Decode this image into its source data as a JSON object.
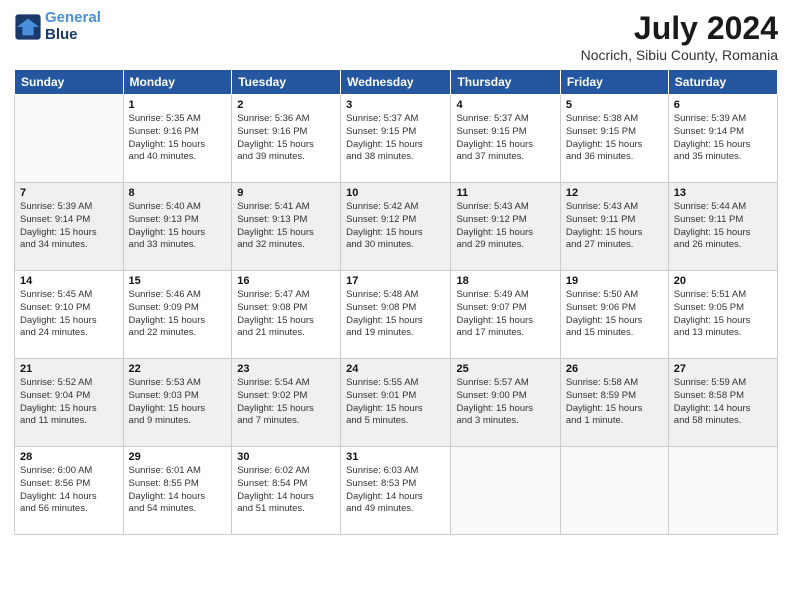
{
  "logo": {
    "line1": "General",
    "line2": "Blue"
  },
  "title": "July 2024",
  "location": "Nocrich, Sibiu County, Romania",
  "weekdays": [
    "Sunday",
    "Monday",
    "Tuesday",
    "Wednesday",
    "Thursday",
    "Friday",
    "Saturday"
  ],
  "weeks": [
    [
      {
        "day": "",
        "info": ""
      },
      {
        "day": "1",
        "info": "Sunrise: 5:35 AM\nSunset: 9:16 PM\nDaylight: 15 hours\nand 40 minutes."
      },
      {
        "day": "2",
        "info": "Sunrise: 5:36 AM\nSunset: 9:16 PM\nDaylight: 15 hours\nand 39 minutes."
      },
      {
        "day": "3",
        "info": "Sunrise: 5:37 AM\nSunset: 9:15 PM\nDaylight: 15 hours\nand 38 minutes."
      },
      {
        "day": "4",
        "info": "Sunrise: 5:37 AM\nSunset: 9:15 PM\nDaylight: 15 hours\nand 37 minutes."
      },
      {
        "day": "5",
        "info": "Sunrise: 5:38 AM\nSunset: 9:15 PM\nDaylight: 15 hours\nand 36 minutes."
      },
      {
        "day": "6",
        "info": "Sunrise: 5:39 AM\nSunset: 9:14 PM\nDaylight: 15 hours\nand 35 minutes."
      }
    ],
    [
      {
        "day": "7",
        "info": "Sunrise: 5:39 AM\nSunset: 9:14 PM\nDaylight: 15 hours\nand 34 minutes."
      },
      {
        "day": "8",
        "info": "Sunrise: 5:40 AM\nSunset: 9:13 PM\nDaylight: 15 hours\nand 33 minutes."
      },
      {
        "day": "9",
        "info": "Sunrise: 5:41 AM\nSunset: 9:13 PM\nDaylight: 15 hours\nand 32 minutes."
      },
      {
        "day": "10",
        "info": "Sunrise: 5:42 AM\nSunset: 9:12 PM\nDaylight: 15 hours\nand 30 minutes."
      },
      {
        "day": "11",
        "info": "Sunrise: 5:43 AM\nSunset: 9:12 PM\nDaylight: 15 hours\nand 29 minutes."
      },
      {
        "day": "12",
        "info": "Sunrise: 5:43 AM\nSunset: 9:11 PM\nDaylight: 15 hours\nand 27 minutes."
      },
      {
        "day": "13",
        "info": "Sunrise: 5:44 AM\nSunset: 9:11 PM\nDaylight: 15 hours\nand 26 minutes."
      }
    ],
    [
      {
        "day": "14",
        "info": "Sunrise: 5:45 AM\nSunset: 9:10 PM\nDaylight: 15 hours\nand 24 minutes."
      },
      {
        "day": "15",
        "info": "Sunrise: 5:46 AM\nSunset: 9:09 PM\nDaylight: 15 hours\nand 22 minutes."
      },
      {
        "day": "16",
        "info": "Sunrise: 5:47 AM\nSunset: 9:08 PM\nDaylight: 15 hours\nand 21 minutes."
      },
      {
        "day": "17",
        "info": "Sunrise: 5:48 AM\nSunset: 9:08 PM\nDaylight: 15 hours\nand 19 minutes."
      },
      {
        "day": "18",
        "info": "Sunrise: 5:49 AM\nSunset: 9:07 PM\nDaylight: 15 hours\nand 17 minutes."
      },
      {
        "day": "19",
        "info": "Sunrise: 5:50 AM\nSunset: 9:06 PM\nDaylight: 15 hours\nand 15 minutes."
      },
      {
        "day": "20",
        "info": "Sunrise: 5:51 AM\nSunset: 9:05 PM\nDaylight: 15 hours\nand 13 minutes."
      }
    ],
    [
      {
        "day": "21",
        "info": "Sunrise: 5:52 AM\nSunset: 9:04 PM\nDaylight: 15 hours\nand 11 minutes."
      },
      {
        "day": "22",
        "info": "Sunrise: 5:53 AM\nSunset: 9:03 PM\nDaylight: 15 hours\nand 9 minutes."
      },
      {
        "day": "23",
        "info": "Sunrise: 5:54 AM\nSunset: 9:02 PM\nDaylight: 15 hours\nand 7 minutes."
      },
      {
        "day": "24",
        "info": "Sunrise: 5:55 AM\nSunset: 9:01 PM\nDaylight: 15 hours\nand 5 minutes."
      },
      {
        "day": "25",
        "info": "Sunrise: 5:57 AM\nSunset: 9:00 PM\nDaylight: 15 hours\nand 3 minutes."
      },
      {
        "day": "26",
        "info": "Sunrise: 5:58 AM\nSunset: 8:59 PM\nDaylight: 15 hours\nand 1 minute."
      },
      {
        "day": "27",
        "info": "Sunrise: 5:59 AM\nSunset: 8:58 PM\nDaylight: 14 hours\nand 58 minutes."
      }
    ],
    [
      {
        "day": "28",
        "info": "Sunrise: 6:00 AM\nSunset: 8:56 PM\nDaylight: 14 hours\nand 56 minutes."
      },
      {
        "day": "29",
        "info": "Sunrise: 6:01 AM\nSunset: 8:55 PM\nDaylight: 14 hours\nand 54 minutes."
      },
      {
        "day": "30",
        "info": "Sunrise: 6:02 AM\nSunset: 8:54 PM\nDaylight: 14 hours\nand 51 minutes."
      },
      {
        "day": "31",
        "info": "Sunrise: 6:03 AM\nSunset: 8:53 PM\nDaylight: 14 hours\nand 49 minutes."
      },
      {
        "day": "",
        "info": ""
      },
      {
        "day": "",
        "info": ""
      },
      {
        "day": "",
        "info": ""
      }
    ]
  ]
}
